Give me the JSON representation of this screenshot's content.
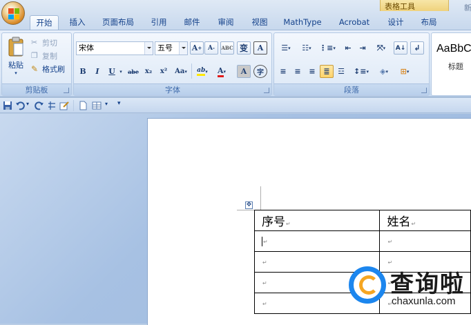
{
  "window": {
    "partial_title_right": "新"
  },
  "tabs": [
    {
      "label": "开始",
      "active": true
    },
    {
      "label": "插入"
    },
    {
      "label": "页面布局"
    },
    {
      "label": "引用"
    },
    {
      "label": "邮件"
    },
    {
      "label": "审阅"
    },
    {
      "label": "视图"
    },
    {
      "label": "MathType"
    },
    {
      "label": "Acrobat"
    },
    {
      "label": "设计",
      "context": true
    },
    {
      "label": "布局",
      "context": true
    }
  ],
  "context_tools_label": "表格工具",
  "clipboard": {
    "group_label": "剪贴板",
    "paste_label": "粘贴",
    "cut_label": "剪切",
    "copy_label": "复制",
    "format_painter_label": "格式刷"
  },
  "font": {
    "group_label": "字体",
    "font_name": "宋体",
    "font_size": "五号",
    "buttons": [
      "B",
      "I",
      "U",
      "abe",
      "x₂",
      "x²",
      "Aa",
      "ab",
      "A",
      "A",
      "字"
    ],
    "grow_label": "A",
    "shrink_label": "A",
    "clear_label": "ABC",
    "phonetic_label": "变",
    "border_label": "A"
  },
  "paragraph": {
    "group_label": "段落"
  },
  "styles": {
    "sample_text": "AaBbC",
    "style_name": "标题"
  },
  "document": {
    "table_header": [
      "序号",
      "姓名"
    ],
    "paragraph_mark": "↵",
    "rows": 5
  },
  "watermark": {
    "cn_text": "查询啦",
    "en_text": "chaxunla.com"
  },
  "colors": {
    "accent": "#15428b",
    "ribbon_top": "#e7effa",
    "workspace": "#a7c1e3",
    "highlight_yellow": "#ffd36a",
    "font_red": "#e01a1a",
    "brand_blue": "#1c86ee",
    "brand_orange": "#f5a623"
  }
}
